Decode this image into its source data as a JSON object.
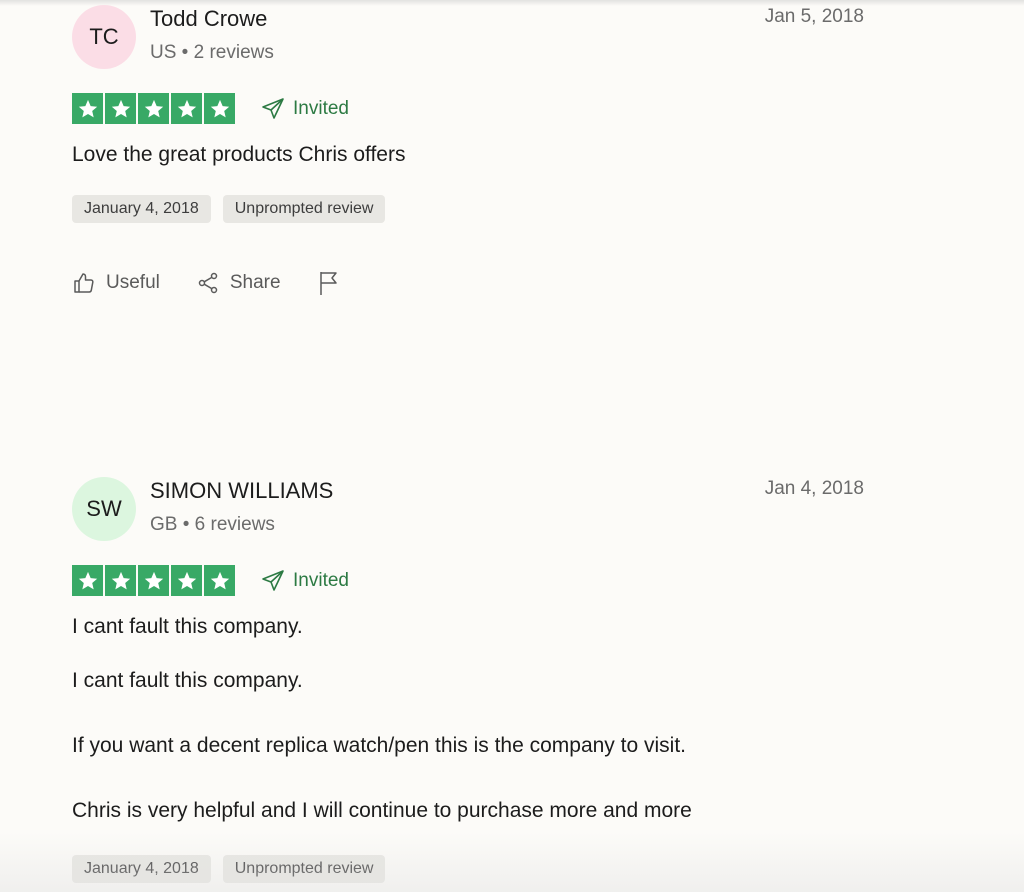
{
  "reviews": [
    {
      "initials": "TC",
      "name": "Todd Crowe",
      "meta": "US • 2 reviews",
      "date": "Jan 5, 2018",
      "rating": 5,
      "invited_label": "Invited",
      "title": "Love the great products Chris offers",
      "body": [],
      "tags": [
        "January 4, 2018",
        "Unprompted review"
      ],
      "actions": {
        "useful": "Useful",
        "share": "Share"
      }
    },
    {
      "initials": "SW",
      "name": "SIMON WILLIAMS",
      "meta": "GB • 6 reviews",
      "date": "Jan 4, 2018",
      "rating": 5,
      "invited_label": "Invited",
      "title": "I cant fault this company.",
      "body": [
        "I cant fault this company.",
        "If you want a decent replica watch/pen this is the company to visit.",
        "Chris is very helpful and I will continue to purchase more and more"
      ],
      "tags": [
        "January 4, 2018",
        "Unprompted review"
      ]
    }
  ],
  "colors": {
    "star_green": "#38a966",
    "invited_green": "#2c7a43",
    "avatar_pink": "#fbdde6",
    "avatar_green": "#dcf6df"
  }
}
